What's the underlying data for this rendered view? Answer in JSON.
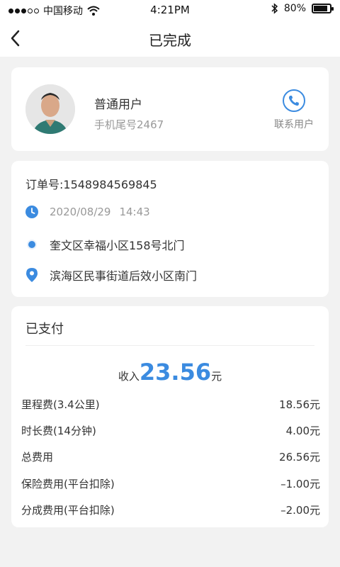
{
  "status_bar": {
    "carrier": "中国移动",
    "time": "4:21PM",
    "battery": "80%"
  },
  "nav": {
    "title": "已完成"
  },
  "user": {
    "name": "普通用户",
    "phone": "手机尾号2467",
    "contact_label": "联系用户"
  },
  "order": {
    "number": "订单号:1548984569845",
    "date": "2020/08/29",
    "time": "14:43",
    "start": "奎文区幸福小区158号北门",
    "end": "滨海区民事街道后效小区南门"
  },
  "payment": {
    "status": "已支付",
    "income_label": "收入",
    "income_amount": "23.56",
    "income_unit": "元",
    "fees": [
      {
        "label": "里程费(3.4公里)",
        "value": "18.56元"
      },
      {
        "label": "时长费(14分钟)",
        "value": "4.00元"
      },
      {
        "label": "总费用",
        "value": "26.56元"
      },
      {
        "label": "保险费用(平台扣除)",
        "value": "–1.00元"
      },
      {
        "label": "分成费用(平台扣除)",
        "value": "–2.00元"
      }
    ]
  },
  "icons": {
    "back": "chevron-left-icon",
    "phone": "phone-icon",
    "clock": "clock-icon",
    "start": "start-dot-icon",
    "end": "location-pin-icon"
  },
  "colors": {
    "accent": "#3b8be0",
    "background": "#f2f2f2",
    "card": "#ffffff"
  }
}
